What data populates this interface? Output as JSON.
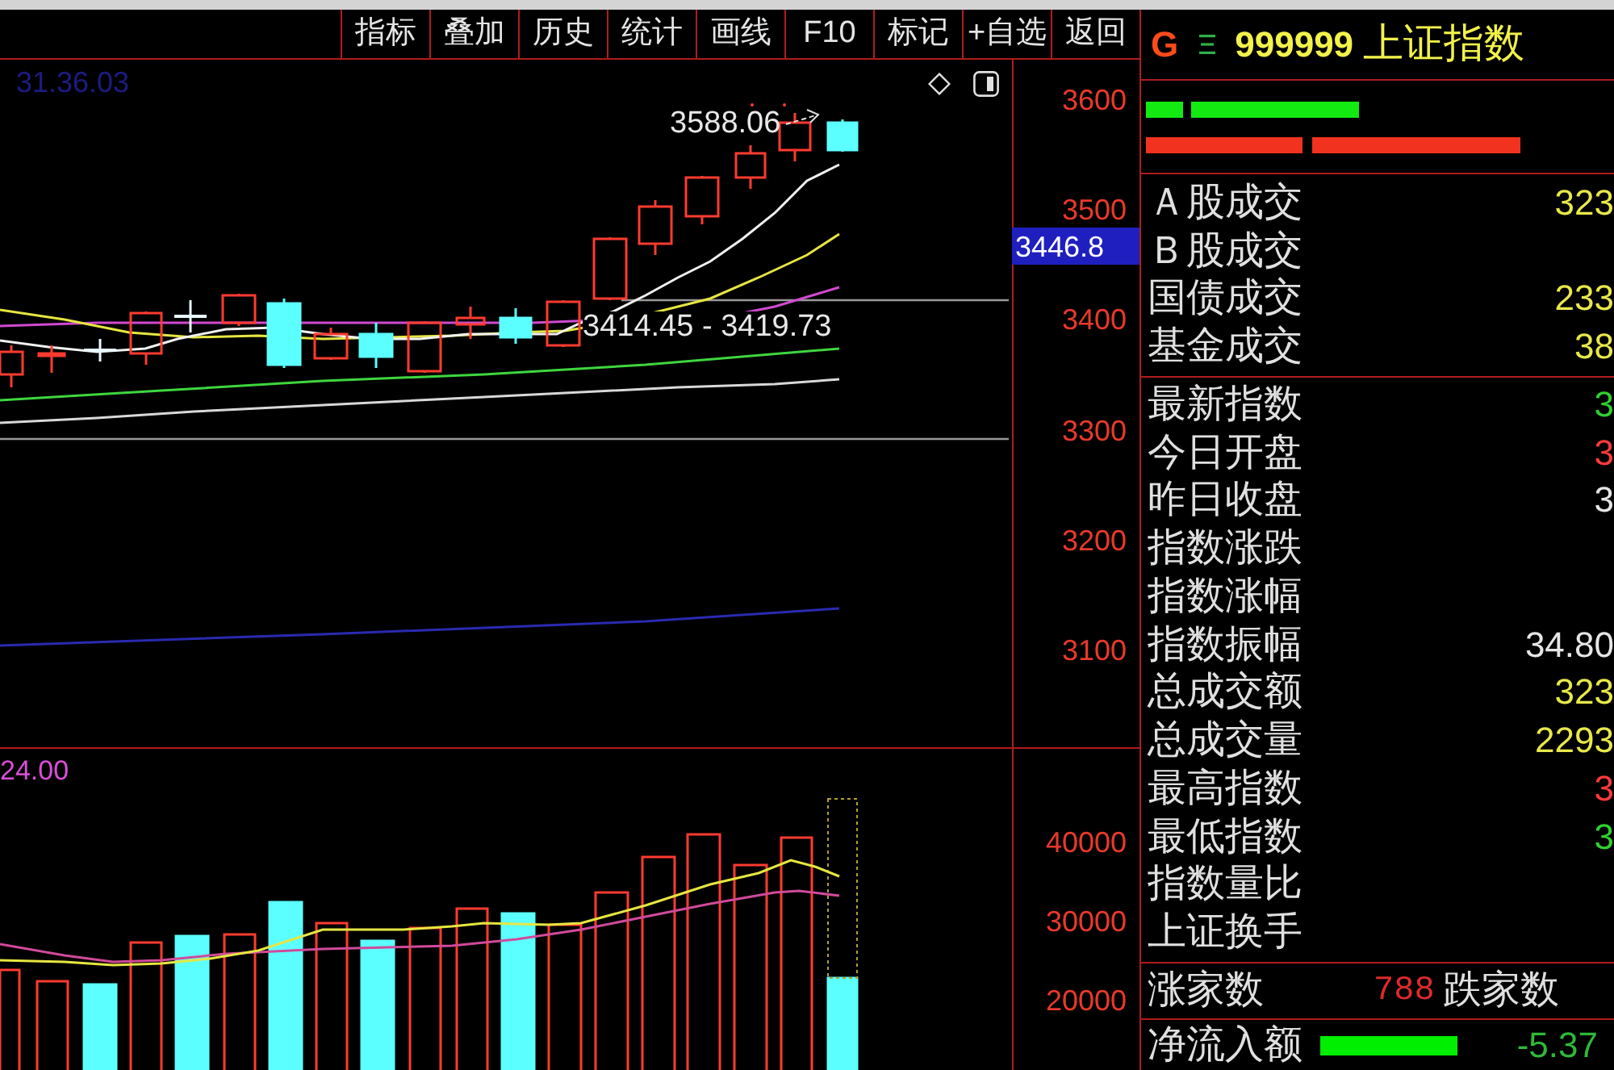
{
  "toolbar": {
    "buttons": [
      "指标",
      "叠加",
      "历史",
      "统计",
      "画线",
      "F10",
      "标记",
      "+自选",
      "返回"
    ]
  },
  "price_chart": {
    "timestamp": "31.36.03",
    "high_label": "3588.06",
    "range_label": "3414.45 - 3419.73",
    "axis_ticks": [
      "3600",
      "3500",
      "3400",
      "3300",
      "3200",
      "3100"
    ],
    "cursor_value": "3446.8"
  },
  "volume_chart": {
    "indicator_value": "24.00",
    "axis_ticks": [
      "40000",
      "30000",
      "20000"
    ]
  },
  "quote_panel": {
    "market_prefix": "G",
    "code": "999999",
    "name": "上证指数",
    "turnover_rows": [
      {
        "label": "Ａ股成交",
        "value": "323",
        "color": "#e8e84a"
      },
      {
        "label": "Ｂ股成交"
      },
      {
        "label": "国债成交",
        "value": "233",
        "color": "#e8e84a"
      },
      {
        "label": "基金成交",
        "value": "38",
        "color": "#e8e84a"
      }
    ],
    "index_rows": [
      {
        "label": "最新指数",
        "value": "3",
        "color": "#30d030"
      },
      {
        "label": "今日开盘",
        "value": "3",
        "color": "#ff3a3a"
      },
      {
        "label": "昨日收盘",
        "value": "3",
        "color": "#e6e6e6"
      },
      {
        "label": "指数涨跌"
      },
      {
        "label": "指数涨幅"
      },
      {
        "label": "指数振幅",
        "value": "34.80",
        "color": "#e6e6e6"
      },
      {
        "label": "总成交额",
        "value": "323",
        "color": "#e8e84a"
      },
      {
        "label": "总成交量",
        "value": "2293",
        "color": "#e8e84a"
      },
      {
        "label": "最高指数",
        "value": "3",
        "color": "#ff3a3a"
      },
      {
        "label": "最低指数",
        "value": "3",
        "color": "#30d030"
      },
      {
        "label": "指数量比"
      },
      {
        "label": "上证换手"
      }
    ],
    "breadth": {
      "advancers_label": "涨家数",
      "advancers": "788",
      "decliners_label": "跌家数"
    },
    "net_inflow": {
      "label": "净流入额",
      "value": "-5.37"
    }
  }
}
